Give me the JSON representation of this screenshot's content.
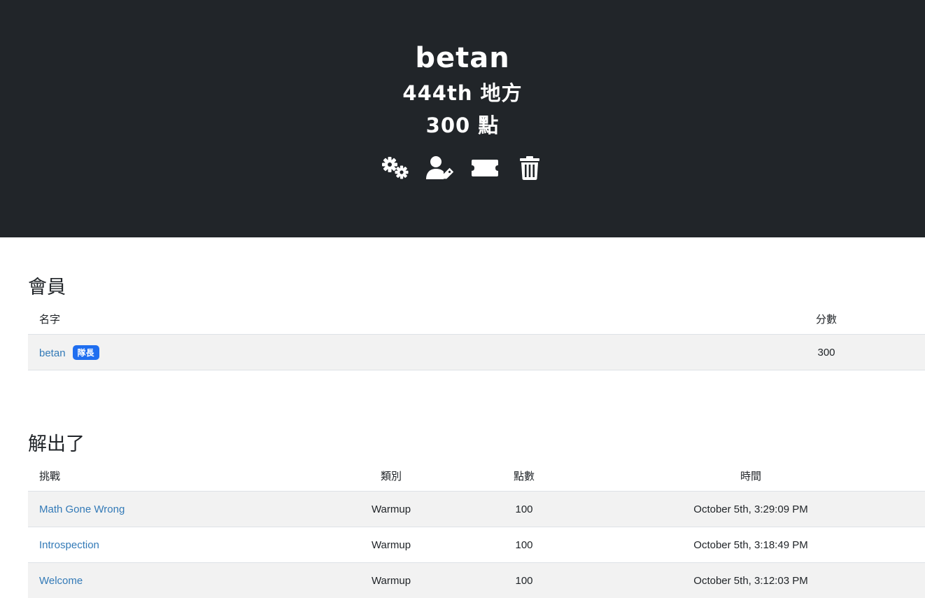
{
  "team": {
    "name": "betan",
    "place": "444th 地方",
    "score": "300 點"
  },
  "icons": [
    "gears-icon",
    "user-tag-icon",
    "ticket-icon",
    "trash-icon"
  ],
  "members": {
    "title": "會員",
    "headers": {
      "name": "名字",
      "score": "分數"
    },
    "rows": [
      {
        "name": "betan",
        "badge": "隊長",
        "score": "300"
      }
    ]
  },
  "solves": {
    "title": "解出了",
    "headers": {
      "challenge": "挑戰",
      "category": "類別",
      "points": "點數",
      "time": "時間"
    },
    "rows": [
      {
        "challenge": "Math Gone Wrong",
        "category": "Warmup",
        "points": "100",
        "time": "October 5th, 3:29:09 PM"
      },
      {
        "challenge": "Introspection",
        "category": "Warmup",
        "points": "100",
        "time": "October 5th, 3:18:49 PM"
      },
      {
        "challenge": "Welcome",
        "category": "Warmup",
        "points": "100",
        "time": "October 5th, 3:12:03 PM"
      }
    ]
  },
  "colors": {
    "header_bg": "#212529",
    "link": "#337ab7",
    "badge": "#1f6ef0",
    "row_stripe": "#f2f2f2"
  }
}
